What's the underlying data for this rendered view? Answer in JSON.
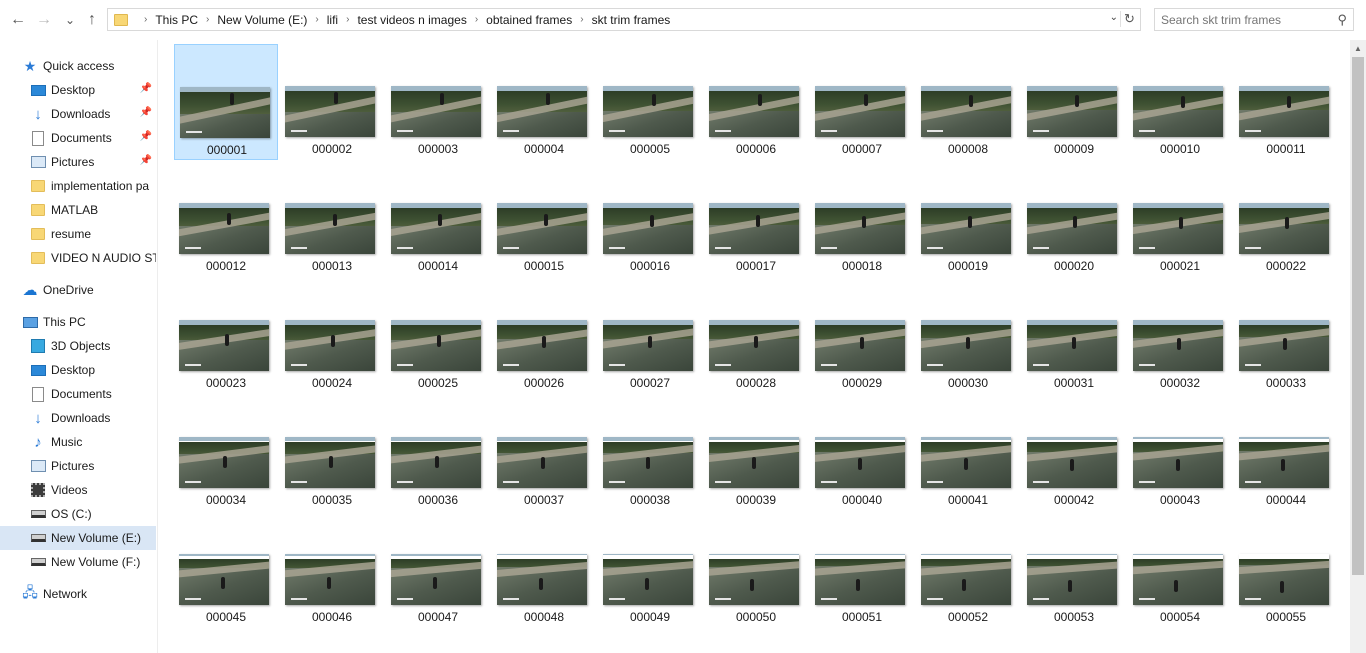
{
  "nav": {
    "back_icon": "arrow-left-icon",
    "forward_icon": "arrow-right-icon",
    "recent_icon": "chevron-down-icon",
    "up_icon": "arrow-up-icon",
    "back_glyph": "←",
    "forward_glyph": "→",
    "recent_glyph": "⌄",
    "up_glyph": "↑"
  },
  "address": {
    "segments": [
      "This PC",
      "New Volume (E:)",
      "lifi",
      "test videos n images",
      "obtained frames",
      "skt trim frames"
    ],
    "separator": "›",
    "dropdown_glyph": "⌄",
    "refresh_glyph": "↻"
  },
  "search": {
    "placeholder": "Search skt trim frames",
    "icon_glyph": "⚲"
  },
  "sidebar": {
    "items": [
      {
        "label": "Quick access",
        "icon": "star-icon",
        "glyph": "★",
        "pinned": false
      },
      {
        "label": "Desktop",
        "icon": "desktop-icon",
        "pinned": true
      },
      {
        "label": "Downloads",
        "icon": "download-icon",
        "glyph": "↓",
        "pinned": true
      },
      {
        "label": "Documents",
        "icon": "document-icon",
        "pinned": true
      },
      {
        "label": "Pictures",
        "icon": "pictures-icon",
        "pinned": true
      },
      {
        "label": "implementation pa",
        "icon": "folder-icon",
        "pinned": false
      },
      {
        "label": "MATLAB",
        "icon": "folder-icon",
        "pinned": false
      },
      {
        "label": "resume",
        "icon": "folder-icon",
        "pinned": false
      },
      {
        "label": "VIDEO N AUDIO STE",
        "icon": "folder-icon",
        "pinned": false
      },
      {
        "label": "OneDrive",
        "icon": "cloud-icon",
        "glyph": "☁",
        "pinned": false
      },
      {
        "label": "This PC",
        "icon": "computer-icon",
        "pinned": false
      },
      {
        "label": "3D Objects",
        "icon": "cube-icon",
        "pinned": false
      },
      {
        "label": "Desktop",
        "icon": "desktop-icon",
        "pinned": false
      },
      {
        "label": "Documents",
        "icon": "document-icon",
        "pinned": false
      },
      {
        "label": "Downloads",
        "icon": "download-icon",
        "glyph": "↓",
        "pinned": false
      },
      {
        "label": "Music",
        "icon": "music-icon",
        "glyph": "♪",
        "pinned": false
      },
      {
        "label": "Pictures",
        "icon": "pictures-icon",
        "pinned": false
      },
      {
        "label": "Videos",
        "icon": "video-icon",
        "pinned": false
      },
      {
        "label": "OS (C:)",
        "icon": "drive-icon",
        "pinned": false
      },
      {
        "label": "New Volume (E:)",
        "icon": "drive-icon",
        "pinned": false,
        "selected": true
      },
      {
        "label": "New Volume (F:)",
        "icon": "drive-icon",
        "pinned": false
      },
      {
        "label": "Network",
        "icon": "network-icon",
        "glyph": "🖧",
        "pinned": false
      }
    ],
    "pin_glyph": "📌"
  },
  "files": {
    "selected": "000001",
    "items": [
      "000001",
      "000002",
      "000003",
      "000004",
      "000005",
      "000006",
      "000007",
      "000008",
      "000009",
      "000010",
      "000011",
      "000012",
      "000013",
      "000014",
      "000015",
      "000016",
      "000017",
      "000018",
      "000019",
      "000020",
      "000021",
      "000022",
      "000023",
      "000024",
      "000025",
      "000026",
      "000027",
      "000028",
      "000029",
      "000030",
      "000031",
      "000032",
      "000033",
      "000034",
      "000035",
      "000036",
      "000037",
      "000038",
      "000039",
      "000040",
      "000041",
      "000042",
      "000043",
      "000044",
      "000045",
      "000046",
      "000047",
      "000048",
      "000049",
      "000050",
      "000051",
      "000052",
      "000053",
      "000054",
      "000055"
    ]
  },
  "scrollbar": {
    "up_glyph": "▲"
  }
}
